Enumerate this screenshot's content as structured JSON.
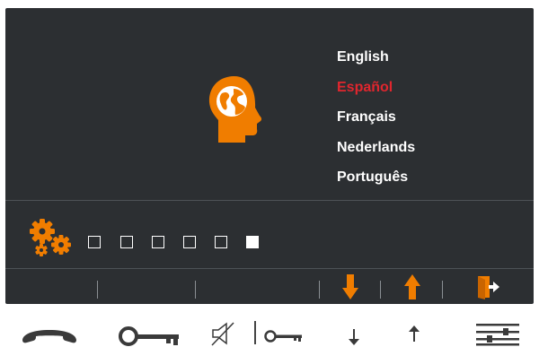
{
  "languages": {
    "items": [
      "English",
      "Español",
      "Français",
      "Nederlands",
      "Português"
    ],
    "selected": "Español",
    "selected_color": "#e0262e"
  },
  "icons": {
    "language": "head-globe-icon",
    "settings": "gears-icon",
    "softkeys": [
      "arrow-down-icon",
      "arrow-up-icon",
      "exit-door-icon"
    ],
    "hardware": [
      "handset-icon",
      "key-icon",
      "mute-icon",
      "small-key-icon",
      "small-arrow-down-icon",
      "small-arrow-up-icon",
      "menu-sliders-icon"
    ]
  },
  "progress": {
    "total_steps": 6,
    "current_step": 6
  },
  "colors": {
    "accent": "#f07d00",
    "background": "#2c2f32",
    "text": "#ffffff",
    "hardware_icons": "#3a3a3a"
  }
}
